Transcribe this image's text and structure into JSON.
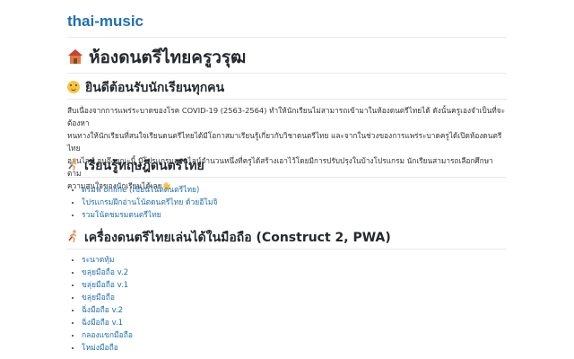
{
  "site": {
    "title": "thai-music"
  },
  "page": {
    "title": "ห้องดนตรีไทยครูวรุฒ",
    "title_icon": "house-icon"
  },
  "welcome": {
    "heading": "ยินดีต้อนรับนักเรียนทุกคน",
    "heading_icon": "smiley-icon",
    "line1": "สืบเนื่องจากการแพร่ระบาดของโรค COVID-19 (2563-2564) ทำให้นักเรียนไม่สามารถเข้ามาในห้องดนตรีไทยได้ ดังนั้นครูเองจำเป็นที่จะต้องหา",
    "line2": "หนทางให้นักเรียนที่สนใจเรียนดนตรีไทยได้มีโอกาสมาเรียนรู้เกี่ยวกับวิชาดนตรีไทย และจากในช่วงของการแพร่ระบาดครูได้เปิดห้องดนตรีไทย",
    "line3": "ออนไลน์ จนถึงขณะนี้ มีโปรแกรมออนไลน์จำนวนหนึ่งที่ครูได้สร้างเอาไว้โดยมีการปรับปรุงในบ้างโปรแกรม นักเรียนสามารถเลือกศึกษาตาม",
    "line4": "ความสนใจของนักเรียนได้เลย👋"
  },
  "theory": {
    "heading": "เรียนรู้ทฤษฎีดนตรีไทย",
    "heading_icon": "runner-icon",
    "links": [
      "ดรมฟ online (เขียนโน้ตดนตรีไทย)",
      "โปรแกรมฝึกอ่านโน้ตดนตรีไทย ด้วยอีโมจิ",
      "รวมโน้ตชมรมดนตรีไทย"
    ]
  },
  "instruments": {
    "heading": "เครื่องดนตรีไทยเล่นได้ในมือถือ (Construct 2, PWA)",
    "heading_icon": "runner-icon",
    "links": [
      "ระนาดทุ้ม",
      "ขลุ่ยมือถือ v.2",
      "ขลุ่ยมือถือ v.1",
      "ขลุ่ยมือถือ",
      "ฉิ่งมือถือ v.2",
      "ฉิ่งมือถือ v.1",
      "กลองแขกมือถือ",
      "โหม่งมือถือ"
    ]
  },
  "colors": {
    "link": "#1f6fb5",
    "text": "#24292e"
  }
}
